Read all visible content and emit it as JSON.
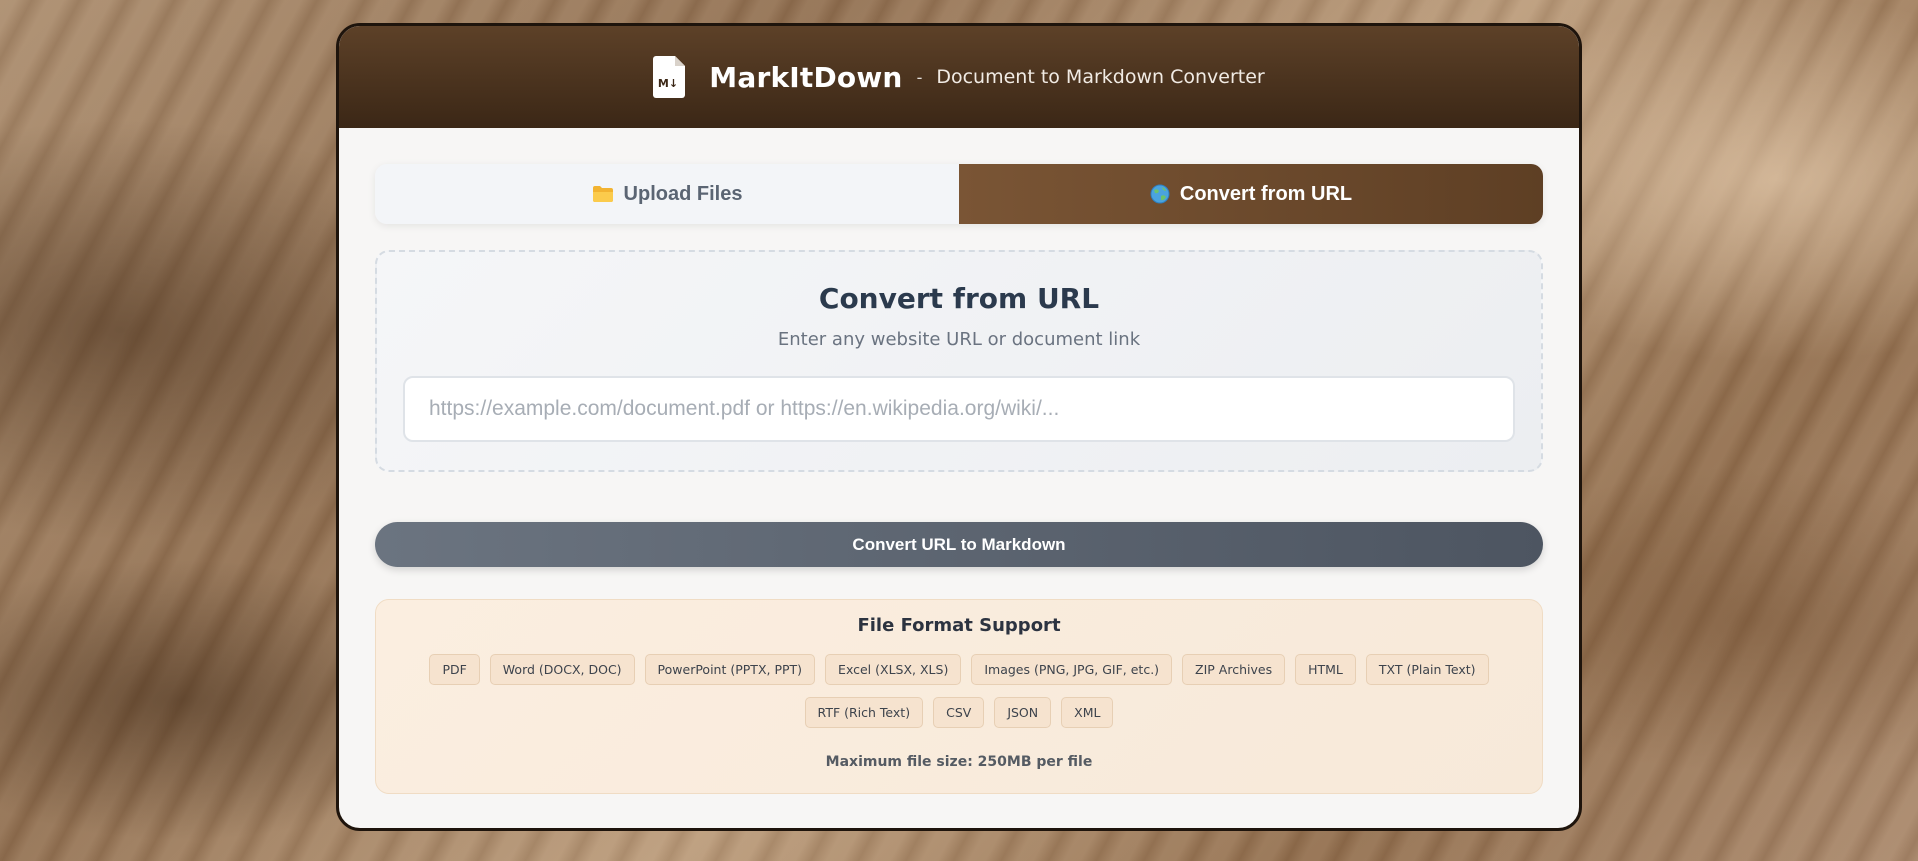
{
  "header": {
    "logo_icon": "markdown-file-icon",
    "logo_mark": "M↓",
    "title": "MarkItDown",
    "separator": "-",
    "subtitle": "Document to Markdown Converter"
  },
  "tabs": [
    {
      "label": "Upload Files",
      "icon": "folder-icon",
      "active": false
    },
    {
      "label": "Convert from URL",
      "icon": "globe-icon",
      "active": true
    }
  ],
  "url_panel": {
    "title": "Convert from URL",
    "subtitle": "Enter any website URL or document link",
    "input_value": "",
    "input_placeholder": "https://example.com/document.pdf or https://en.wikipedia.org/wiki/..."
  },
  "convert_button": {
    "label": "Convert URL to Markdown"
  },
  "formats": {
    "title": "File Format Support",
    "items": [
      "PDF",
      "Word (DOCX, DOC)",
      "PowerPoint (PPTX, PPT)",
      "Excel (XLSX, XLS)",
      "Images (PNG, JPG, GIF, etc.)",
      "ZIP Archives",
      "HTML",
      "TXT (Plain Text)",
      "RTF (Rich Text)",
      "CSV",
      "JSON",
      "XML"
    ],
    "max_size": "Maximum file size: 250MB per file"
  },
  "colors": {
    "header_bg": "#4a331f",
    "active_tab": "#6e4b2e",
    "button": "#5d6571",
    "formats_bg": "#f9ecdd"
  }
}
